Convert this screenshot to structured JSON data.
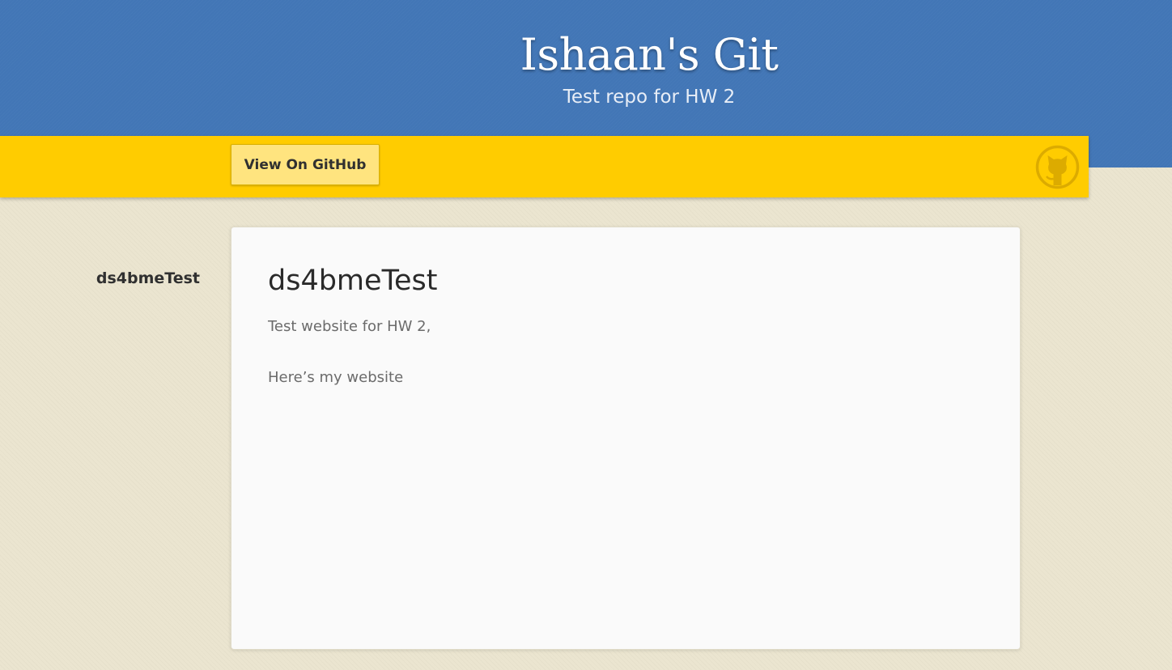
{
  "header": {
    "title": "Ishaan's Git",
    "subtitle": "Test repo for HW 2"
  },
  "banner": {
    "view_button_label": "View On GitHub",
    "github_icon": "github-octocat-icon"
  },
  "sidebar": {
    "project_name": "ds4bmeTest"
  },
  "main": {
    "heading": "ds4bmeTest",
    "paragraphs": [
      "Test website for HW 2,",
      "Here’s my website"
    ]
  },
  "colors": {
    "header_blue": "#4276b6",
    "banner_yellow": "#ffcc00",
    "button_yellow": "#ffe47f",
    "page_beige": "#ebe5d0",
    "card_white": "#fafafa"
  }
}
